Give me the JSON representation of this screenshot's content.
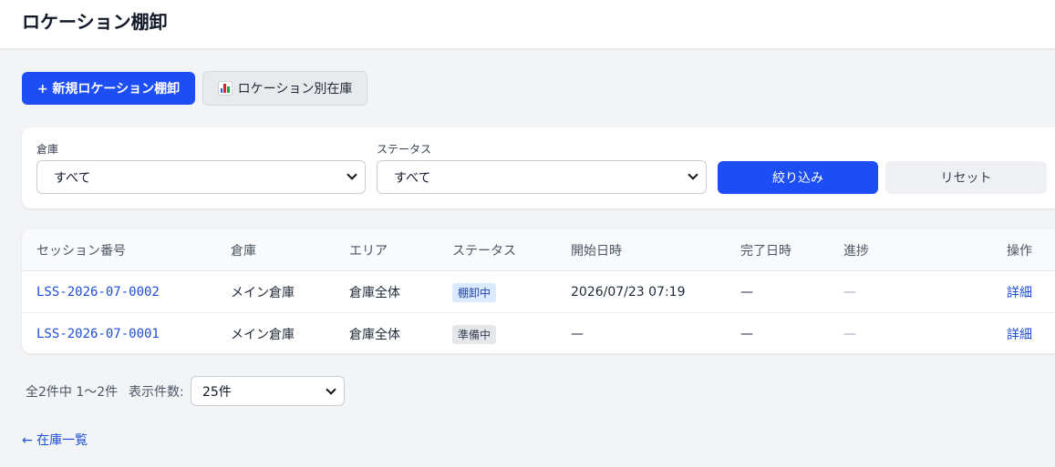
{
  "header": {
    "title": "ロケーション棚卸"
  },
  "actions": {
    "new_label": "+ 新規ロケーション棚卸",
    "inventory_label": "ロケーション別在庫"
  },
  "filters": {
    "warehouse_label": "倉庫",
    "warehouse_value": "すべて",
    "status_label": "ステータス",
    "status_value": "すべて",
    "apply_label": "絞り込み",
    "reset_label": "リセット"
  },
  "table": {
    "headers": [
      "セッション番号",
      "倉庫",
      "エリア",
      "ステータス",
      "開始日時",
      "完了日時",
      "進捗",
      "操作"
    ],
    "rows": [
      {
        "session": "LSS-2026-07-0002",
        "warehouse": "メイン倉庫",
        "area": "倉庫全体",
        "status": "棚卸中",
        "started": "2026/07/23 07:19",
        "completed": "—",
        "progress": "—",
        "action": "詳細"
      },
      {
        "session": "LSS-2026-07-0001",
        "warehouse": "メイン倉庫",
        "area": "倉庫全体",
        "status": "準備中",
        "started": "—",
        "completed": "—",
        "progress": "—",
        "action": "詳細"
      }
    ]
  },
  "status_colors": {
    "棚卸中": {
      "bg": "#dbeafe",
      "fg": "#1e40af"
    },
    "準備中": {
      "bg": "#e5e7eb",
      "fg": "#374151"
    }
  },
  "pagination": {
    "summary": "全2件中 1〜2件",
    "per_page_label": "表示件数:",
    "per_page_value": "25件"
  },
  "footer": {
    "back_label": "← 在庫一覧"
  }
}
